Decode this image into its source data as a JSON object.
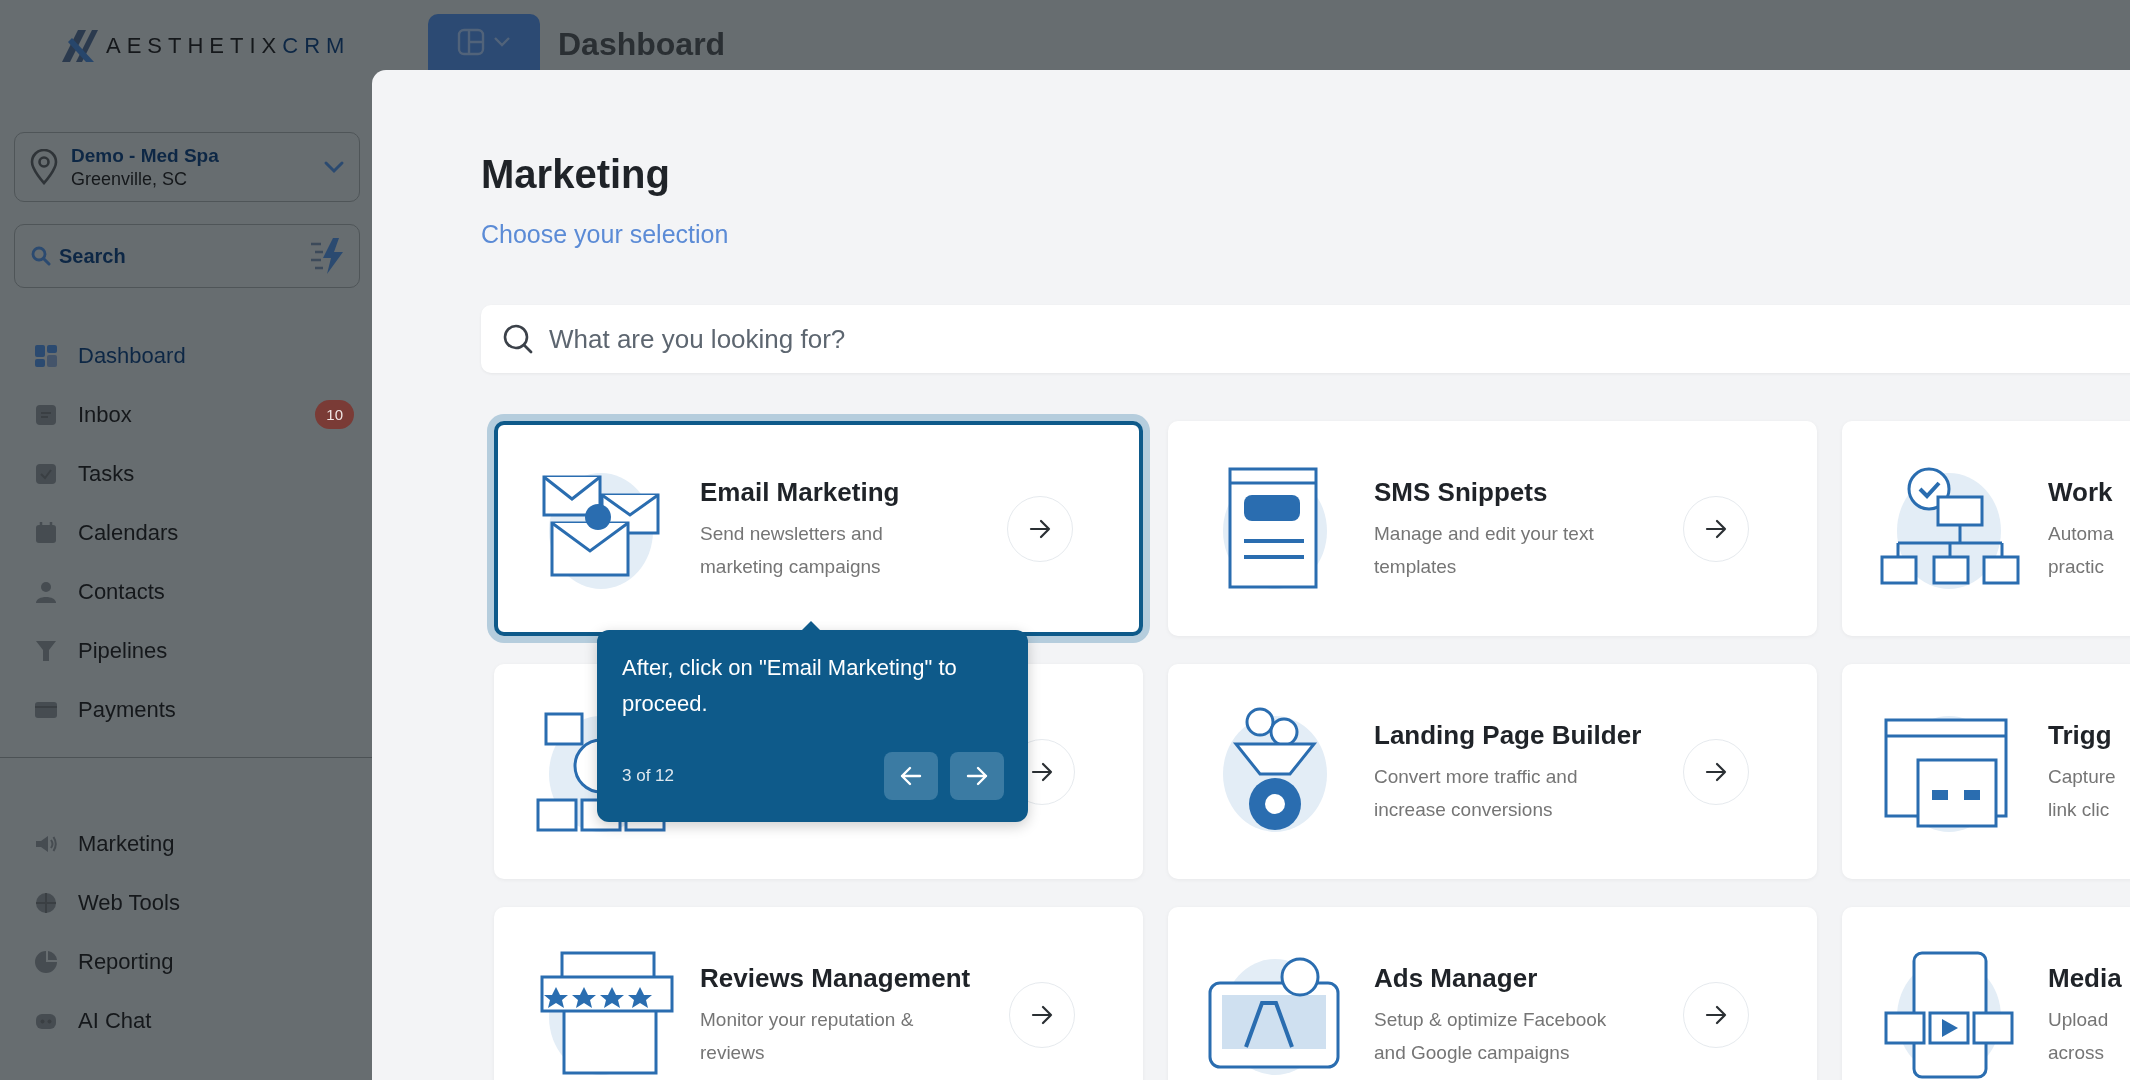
{
  "sidebar": {
    "logo": {
      "text": "AESTHETIX",
      "accent": "CRM"
    },
    "location": {
      "name": "Demo - Med Spa",
      "address": "Greenville, SC"
    },
    "search": {
      "label": "Search"
    },
    "nav": [
      {
        "label": "Dashboard",
        "selected": true
      },
      {
        "label": "Inbox",
        "selected": false,
        "badge": "10"
      },
      {
        "label": "Tasks",
        "selected": false
      },
      {
        "label": "Calendars",
        "selected": false
      },
      {
        "label": "Contacts",
        "selected": false
      },
      {
        "label": "Pipelines",
        "selected": false
      },
      {
        "label": "Payments",
        "selected": false
      }
    ],
    "nav_secondary": [
      {
        "label": "Marketing",
        "selected": false
      },
      {
        "label": "Web Tools",
        "selected": false
      },
      {
        "label": "Reporting",
        "selected": false
      },
      {
        "label": "AI Chat",
        "selected": false
      }
    ]
  },
  "header": {
    "title": "Dashboard"
  },
  "modal": {
    "title": "Marketing",
    "subtitle": "Choose your selection",
    "search": {
      "placeholder": "What are you looking for?"
    },
    "cards": [
      {
        "title": "Email Marketing",
        "description_lines": [
          "Send newsletters and",
          "marketing campaigns"
        ],
        "selected": true
      },
      {
        "title": "SMS Snippets",
        "description_lines": [
          "Manage and edit your text",
          "templates"
        ],
        "selected": false
      },
      {
        "title": "Work",
        "description_lines": [
          "Automa",
          "practic"
        ],
        "selected": false
      },
      {
        "selected": false
      },
      {
        "title": "Landing Page Builder",
        "description_lines": [
          "Convert more traffic and",
          "increase conversions"
        ],
        "selected": false
      },
      {
        "title": "Trigg",
        "description_lines": [
          "Capture",
          "link clic"
        ],
        "selected": false
      },
      {
        "title": "Reviews Management",
        "description_lines": [
          "Monitor your reputation &",
          "reviews"
        ],
        "selected": false
      },
      {
        "title": "Ads Manager",
        "description_lines": [
          "Setup & optimize Facebook",
          "and Google campaigns"
        ],
        "selected": false
      },
      {
        "title": "Media",
        "description_lines": [
          "Upload",
          "across"
        ],
        "selected": false
      }
    ]
  },
  "tooltip": {
    "text": "After, click on \"Email Marketing\" to proceed.",
    "step": "3 of 12"
  }
}
